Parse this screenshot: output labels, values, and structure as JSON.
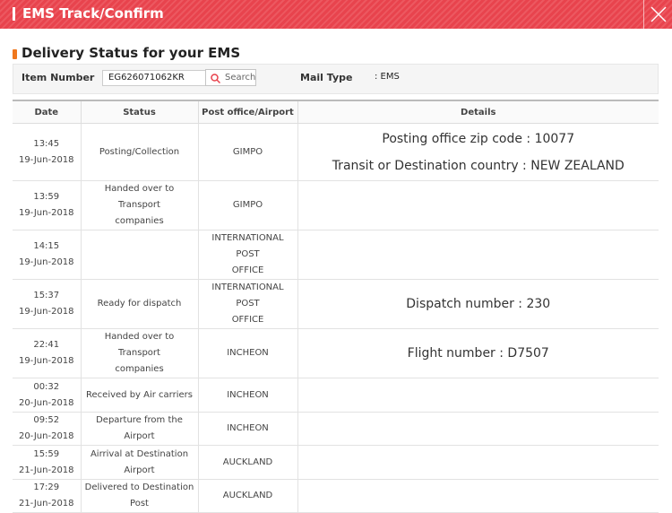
{
  "window": {
    "title": "EMS Track/Confirm"
  },
  "section": {
    "title": "Delivery Status for your EMS"
  },
  "search": {
    "item_number_label": "Item Number",
    "item_number_value": "EG626071062KR",
    "search_button": "Search",
    "mail_type_label": "Mail Type",
    "mail_type_value": ": EMS"
  },
  "table": {
    "headers": {
      "date": "Date",
      "status": "Status",
      "office": "Post office/Airport",
      "details": "Details"
    },
    "rows": [
      {
        "time": "13:45",
        "date": "19-Jun-2018",
        "status": [
          "Posting/Collection",
          ""
        ],
        "office": [
          "GIMPO",
          ""
        ],
        "details": [
          "Posting office zip code : 10077",
          "Transit or Destination country : NEW ZEALAND"
        ]
      },
      {
        "time": "13:59",
        "date": "19-Jun-2018",
        "status": [
          "Handed over to Transport",
          "companies"
        ],
        "office": [
          "GIMPO",
          ""
        ],
        "details": [
          "",
          ""
        ]
      },
      {
        "time": "14:15",
        "date": "19-Jun-2018",
        "status": [
          "",
          ""
        ],
        "office": [
          "INTERNATIONAL POST",
          "OFFICE"
        ],
        "details": [
          "",
          ""
        ]
      },
      {
        "time": "15:37",
        "date": "19-Jun-2018",
        "status": [
          "Ready for dispatch",
          ""
        ],
        "office": [
          "INTERNATIONAL POST",
          "OFFICE"
        ],
        "details": [
          "Dispatch number : 230",
          ""
        ]
      },
      {
        "time": "22:41",
        "date": "19-Jun-2018",
        "status": [
          "Handed over to Transport",
          "companies"
        ],
        "office": [
          "INCHEON",
          ""
        ],
        "details": [
          "Flight number : D7507",
          ""
        ]
      },
      {
        "time": "00:32",
        "date": "20-Jun-2018",
        "status": [
          "Received by Air carriers",
          ""
        ],
        "office": [
          "INCHEON",
          ""
        ],
        "details": [
          "",
          ""
        ]
      },
      {
        "time": "09:52",
        "date": "20-Jun-2018",
        "status": [
          "Departure from the Airport",
          ""
        ],
        "office": [
          "INCHEON",
          ""
        ],
        "details": [
          "",
          ""
        ]
      },
      {
        "time": "15:59",
        "date": "21-Jun-2018",
        "status": [
          "Airrival at Destination Airport",
          ""
        ],
        "office": [
          "AUCKLAND",
          ""
        ],
        "details": [
          "",
          ""
        ]
      },
      {
        "time": "17:29",
        "date": "21-Jun-2018",
        "status": [
          "Delivered to Destination Post",
          ""
        ],
        "office": [
          "AUCKLAND",
          ""
        ],
        "details": [
          "",
          ""
        ]
      }
    ]
  },
  "colors": {
    "title_bar": "#e8434d",
    "section_bullet": "#f0781e"
  },
  "icons": {
    "close": "close-icon",
    "search": "search-icon"
  }
}
